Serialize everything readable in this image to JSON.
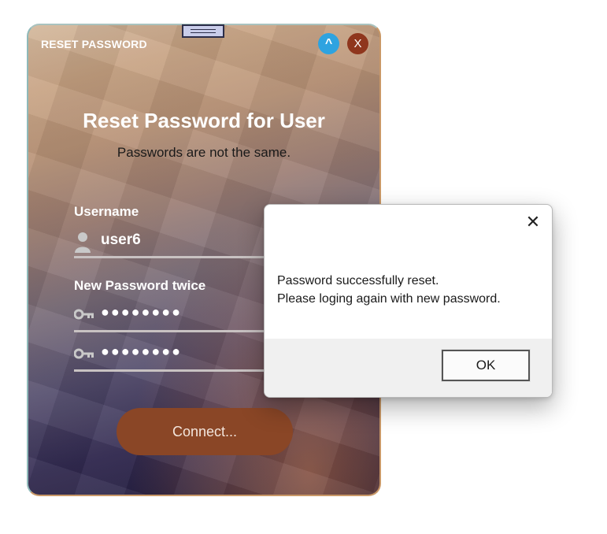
{
  "window": {
    "title": "RESET PASSWORD",
    "minimize_label": "^",
    "close_label": "X"
  },
  "form": {
    "heading": "Reset Password for User",
    "status_message": "Passwords are not the same.",
    "username_label": "Username",
    "username_value": "user6",
    "password_label": "New Password twice",
    "password1_mask": "●●●●●●●●",
    "password2_mask": "●●●●●●●●",
    "connect_label": "Connect..."
  },
  "dialog": {
    "close_glyph": "✕",
    "line1": "Password successfully reset.",
    "line2": "Please loging again with new password.",
    "ok_label": "OK"
  },
  "icons": {
    "user": "user-icon",
    "key": "key-icon",
    "drag_handle": "drag-handle-icon"
  },
  "colors": {
    "minimize_button": "#2ea3e0",
    "close_button": "#8f361d",
    "connect_button": "#8a4626"
  }
}
